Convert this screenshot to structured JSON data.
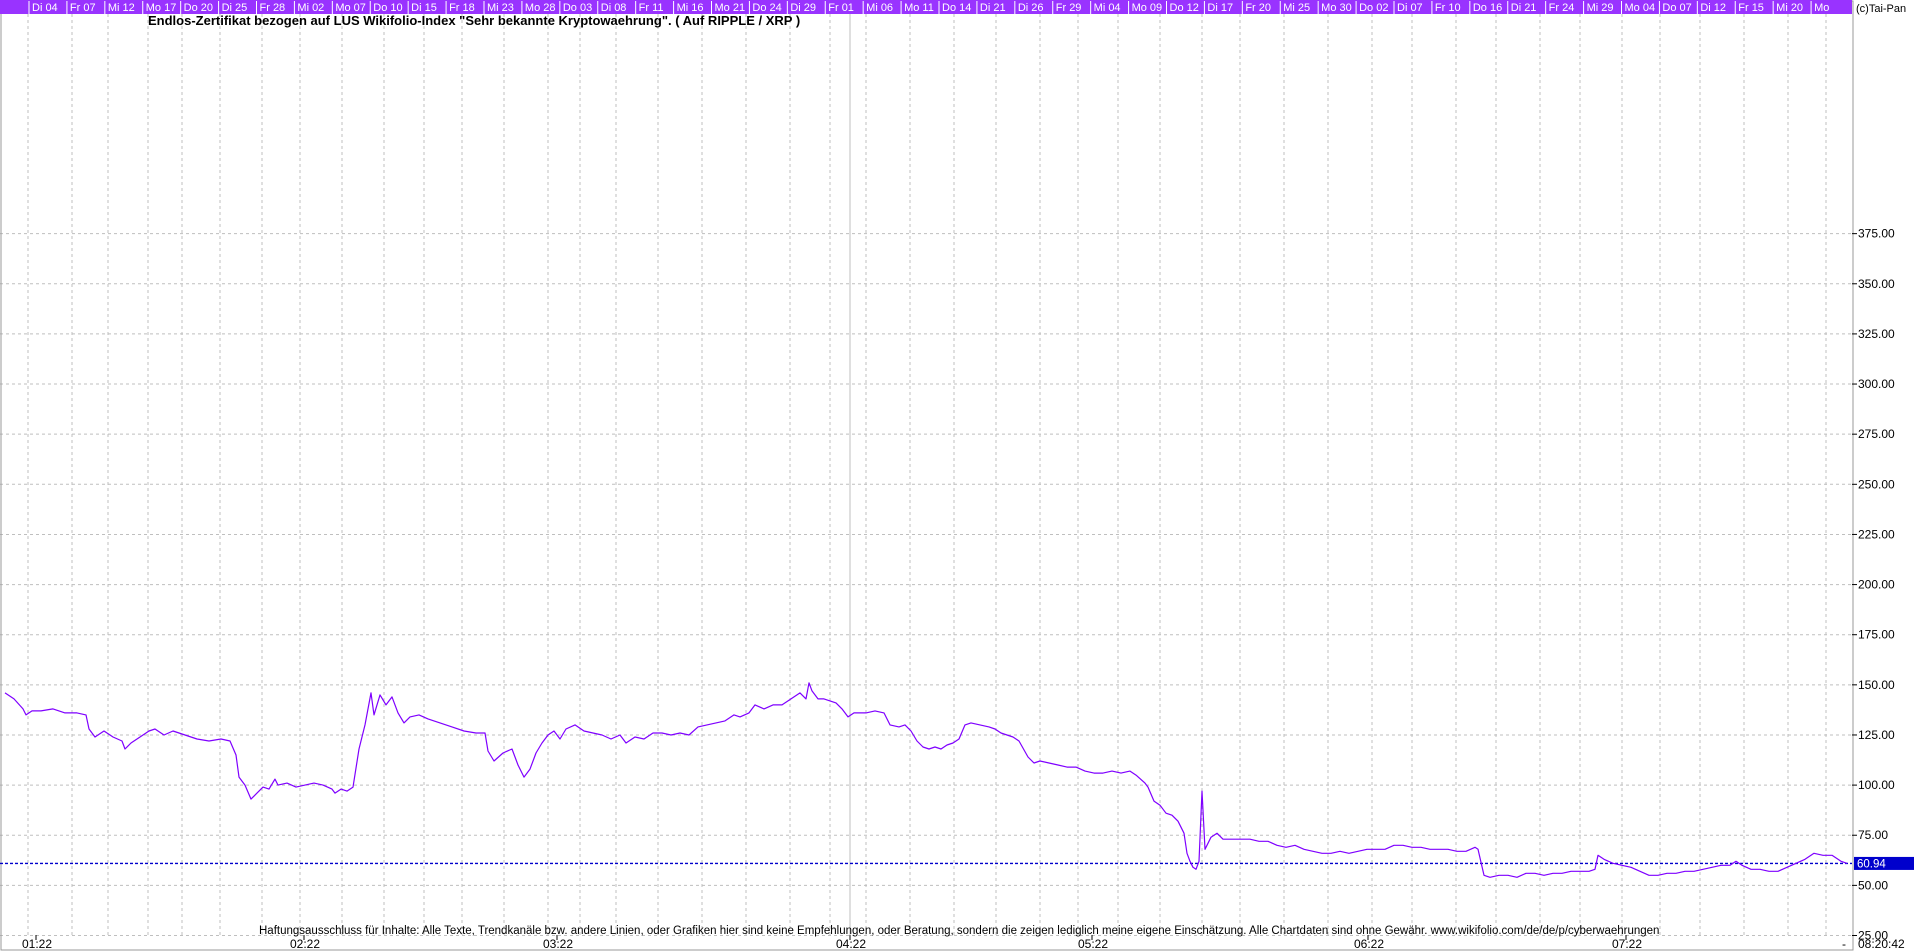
{
  "chart_data": {
    "type": "line",
    "title": "Endlos-Zertifikat bezogen auf LUS Wikifolio-Index \"Sehr bekannte Kryptowaehrung\". ( Auf RIPPLE / XRP )",
    "copyright": "(c)Tai-Pan",
    "disclaimer": "Haftungsausschluss für Inhalte: Alle Texte, Trendkanäle bzw. andere Linien, oder Grafiken hier sind keine Empfehlungen, oder Beratung, sondern die zeigen lediglich meine eigene Einschätzung. Alle Chartdaten sind ohne Gewähr.  www.wikifolio.com/de/de/p/cyberwaehrungen",
    "current_value_label": "60.94",
    "current_value": 60.94,
    "time_label": "08:20:42",
    "dash_label": "-",
    "ylim": [
      25,
      400
    ],
    "yticks": [
      "375.00",
      "350.00",
      "325.00",
      "300.00",
      "275.00",
      "250.00",
      "225.00",
      "200.00",
      "175.00",
      "150.00",
      "125.00",
      "100.00",
      "75.00",
      "50.00",
      "25.00"
    ],
    "xtick_labels": [
      "01:22",
      "02:22",
      "03:22",
      "04:22",
      "05:22",
      "06:22",
      "07:22"
    ],
    "day_labels": [
      "Di 04",
      "Fr 07",
      "Mi 12",
      "Mo 17",
      "Do 20",
      "Di 25",
      "Fr 28",
      "Mi 02",
      "Mo 07",
      "Do 10",
      "Di 15",
      "Fr 18",
      "Mi 23",
      "Mo 28",
      "Do 03",
      "Di 08",
      "Fr 11",
      "Mi 16",
      "Mo 21",
      "Do 24",
      "Di 29",
      "Fr 01",
      "Mi 06",
      "Mo 11",
      "Do 14",
      "Di 21",
      "Di 26",
      "Fr 29",
      "Mi 04",
      "Mo 09",
      "Do 12",
      "Di 17",
      "Fr 20",
      "Mi 25",
      "Mo 30",
      "Do 02",
      "Di 07",
      "Fr 10",
      "Do 16",
      "Di 21",
      "Fr 24",
      "Mi 29",
      "Mo 04",
      "Do 07",
      "Di 12",
      "Fr 15",
      "Mi 20",
      "Mo"
    ],
    "grid": true,
    "series": [
      {
        "color": "#7f00ff",
        "points": [
          [
            0,
            146
          ],
          [
            3,
            143
          ],
          [
            6,
            138
          ],
          [
            7,
            135
          ],
          [
            9,
            137
          ],
          [
            12,
            137
          ],
          [
            16,
            138
          ],
          [
            20,
            136
          ],
          [
            24,
            136
          ],
          [
            27,
            135
          ],
          [
            28,
            128
          ],
          [
            30,
            124
          ],
          [
            33,
            127
          ],
          [
            36,
            124
          ],
          [
            39,
            122
          ],
          [
            40,
            118
          ],
          [
            42,
            121
          ],
          [
            45,
            124
          ],
          [
            48,
            127
          ],
          [
            50,
            128
          ],
          [
            53,
            125
          ],
          [
            56,
            127
          ],
          [
            60,
            125
          ],
          [
            64,
            123
          ],
          [
            68,
            122
          ],
          [
            72,
            123
          ],
          [
            75,
            122
          ],
          [
            77,
            115
          ],
          [
            78,
            104
          ],
          [
            80,
            100
          ],
          [
            82,
            93
          ],
          [
            84,
            96
          ],
          [
            86,
            99
          ],
          [
            88,
            98
          ],
          [
            90,
            103
          ],
          [
            91,
            100
          ],
          [
            94,
            101
          ],
          [
            97,
            99
          ],
          [
            100,
            100
          ],
          [
            103,
            101
          ],
          [
            106,
            100
          ],
          [
            109,
            98
          ],
          [
            110,
            96
          ],
          [
            112,
            98
          ],
          [
            114,
            97
          ],
          [
            116,
            99
          ],
          [
            118,
            118
          ],
          [
            120,
            130
          ],
          [
            122,
            146
          ],
          [
            123,
            135
          ],
          [
            125,
            145
          ],
          [
            127,
            140
          ],
          [
            129,
            144
          ],
          [
            131,
            136
          ],
          [
            133,
            131
          ],
          [
            135,
            134
          ],
          [
            138,
            135
          ],
          [
            141,
            133
          ],
          [
            145,
            131
          ],
          [
            149,
            129
          ],
          [
            153,
            127
          ],
          [
            157,
            126
          ],
          [
            160,
            126
          ],
          [
            161,
            117
          ],
          [
            163,
            112
          ],
          [
            166,
            116
          ],
          [
            169,
            118
          ],
          [
            171,
            110
          ],
          [
            173,
            104
          ],
          [
            175,
            108
          ],
          [
            177,
            116
          ],
          [
            179,
            121
          ],
          [
            181,
            125
          ],
          [
            183,
            127
          ],
          [
            185,
            123
          ],
          [
            187,
            128
          ],
          [
            190,
            130
          ],
          [
            193,
            127
          ],
          [
            196,
            126
          ],
          [
            199,
            125
          ],
          [
            202,
            123
          ],
          [
            205,
            125
          ],
          [
            207,
            121
          ],
          [
            210,
            124
          ],
          [
            213,
            123
          ],
          [
            216,
            126
          ],
          [
            219,
            126
          ],
          [
            222,
            125
          ],
          [
            225,
            126
          ],
          [
            228,
            125
          ],
          [
            231,
            129
          ],
          [
            234,
            130
          ],
          [
            237,
            131
          ],
          [
            240,
            132
          ],
          [
            243,
            135
          ],
          [
            245,
            134
          ],
          [
            248,
            136
          ],
          [
            250,
            140
          ],
          [
            253,
            138
          ],
          [
            256,
            140
          ],
          [
            259,
            140
          ],
          [
            262,
            143
          ],
          [
            265,
            146
          ],
          [
            267,
            143
          ],
          [
            268,
            151
          ],
          [
            269,
            147
          ],
          [
            271,
            143
          ],
          [
            273,
            143
          ],
          [
            275,
            142
          ],
          [
            277,
            141
          ],
          [
            279,
            138
          ],
          [
            281,
            134
          ],
          [
            283,
            136
          ],
          [
            285,
            136
          ],
          [
            287,
            136
          ],
          [
            290,
            137
          ],
          [
            293,
            136
          ],
          [
            295,
            130
          ],
          [
            298,
            129
          ],
          [
            300,
            130
          ],
          [
            302,
            127
          ],
          [
            304,
            122
          ],
          [
            306,
            119
          ],
          [
            308,
            118
          ],
          [
            310,
            119
          ],
          [
            312,
            118
          ],
          [
            314,
            120
          ],
          [
            316,
            121
          ],
          [
            318,
            123
          ],
          [
            320,
            130
          ],
          [
            322,
            131
          ],
          [
            325,
            130
          ],
          [
            328,
            129
          ],
          [
            330,
            128
          ],
          [
            332,
            126
          ],
          [
            334,
            125
          ],
          [
            336,
            124
          ],
          [
            338,
            122
          ],
          [
            341,
            114
          ],
          [
            343,
            111
          ],
          [
            345,
            112
          ],
          [
            348,
            111
          ],
          [
            351,
            110
          ],
          [
            354,
            109
          ],
          [
            357,
            109
          ],
          [
            360,
            107
          ],
          [
            363,
            106
          ],
          [
            366,
            106
          ],
          [
            369,
            107
          ],
          [
            372,
            106
          ],
          [
            375,
            107
          ],
          [
            377,
            105
          ],
          [
            380,
            101
          ],
          [
            381,
            99
          ],
          [
            383,
            92
          ],
          [
            385,
            90
          ],
          [
            387,
            86
          ],
          [
            389,
            85
          ],
          [
            391,
            82
          ],
          [
            393,
            76
          ],
          [
            394,
            66
          ],
          [
            395,
            62
          ],
          [
            396,
            59
          ],
          [
            397,
            58
          ],
          [
            398,
            62
          ],
          [
            399,
            97
          ],
          [
            400,
            68
          ],
          [
            402,
            74
          ],
          [
            404,
            76
          ],
          [
            406,
            73
          ],
          [
            409,
            73
          ],
          [
            412,
            73
          ],
          [
            415,
            73
          ],
          [
            418,
            72
          ],
          [
            421,
            72
          ],
          [
            424,
            70
          ],
          [
            427,
            69
          ],
          [
            430,
            70
          ],
          [
            433,
            68
          ],
          [
            436,
            67
          ],
          [
            439,
            66
          ],
          [
            442,
            66
          ],
          [
            445,
            67
          ],
          [
            448,
            66
          ],
          [
            451,
            67
          ],
          [
            454,
            68
          ],
          [
            457,
            68
          ],
          [
            460,
            68
          ],
          [
            463,
            70
          ],
          [
            466,
            70
          ],
          [
            469,
            69
          ],
          [
            472,
            69
          ],
          [
            475,
            68
          ],
          [
            478,
            68
          ],
          [
            481,
            68
          ],
          [
            484,
            67
          ],
          [
            487,
            67
          ],
          [
            490,
            69
          ],
          [
            491,
            68
          ],
          [
            493,
            55
          ],
          [
            495,
            54
          ],
          [
            498,
            55
          ],
          [
            501,
            55
          ],
          [
            504,
            54
          ],
          [
            507,
            56
          ],
          [
            510,
            56
          ],
          [
            513,
            55
          ],
          [
            516,
            56
          ],
          [
            519,
            56
          ],
          [
            522,
            57
          ],
          [
            525,
            57
          ],
          [
            528,
            57
          ],
          [
            530,
            58
          ],
          [
            531,
            65
          ],
          [
            533,
            63
          ],
          [
            536,
            61
          ],
          [
            539,
            60
          ],
          [
            542,
            59
          ],
          [
            545,
            57
          ],
          [
            548,
            55
          ],
          [
            551,
            55
          ],
          [
            554,
            56
          ],
          [
            557,
            56
          ],
          [
            560,
            57
          ],
          [
            563,
            57
          ],
          [
            566,
            58
          ],
          [
            569,
            59
          ],
          [
            572,
            60
          ],
          [
            575,
            60
          ],
          [
            577,
            62
          ],
          [
            579,
            60
          ],
          [
            582,
            58
          ],
          [
            585,
            58
          ],
          [
            588,
            57
          ],
          [
            591,
            57
          ],
          [
            594,
            59
          ],
          [
            597,
            61
          ],
          [
            600,
            63
          ],
          [
            603,
            66
          ],
          [
            606,
            65
          ],
          [
            609,
            65
          ],
          [
            612,
            62
          ],
          [
            614,
            61
          ]
        ]
      }
    ]
  }
}
